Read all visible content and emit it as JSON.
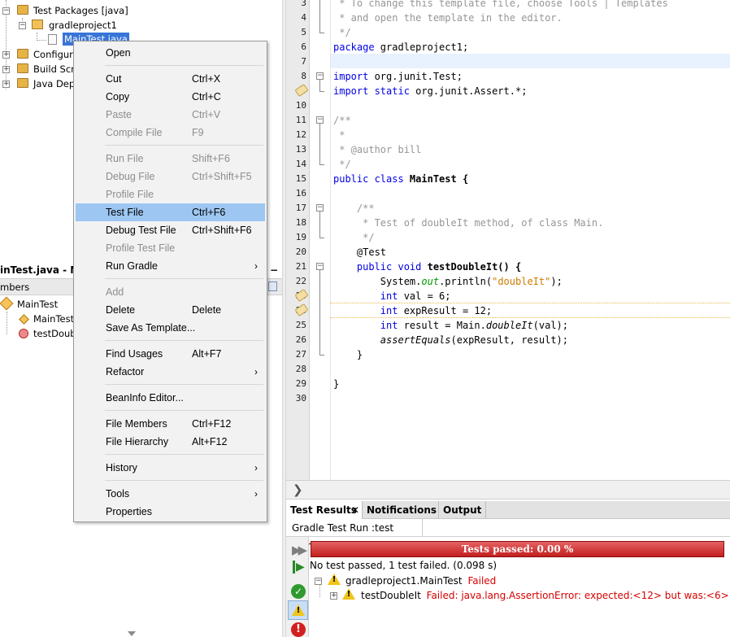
{
  "tree": {
    "test_packages": "Test Packages [java]",
    "package": "gradleproject1",
    "file": "MainTest.java",
    "configuration": "Configura",
    "build_scripts": "Build Scrip",
    "java_dependencies": "Java Depe"
  },
  "navigator": {
    "title": "inTest.java - Navi",
    "members_label": "mbers",
    "class_name": "MainTest",
    "constructor": "MainTest(",
    "method": "testDouble"
  },
  "context_menu": {
    "items": [
      {
        "label": "Open",
        "accel": "",
        "enabled": true
      },
      {
        "label": "Cut",
        "accel": "Ctrl+X",
        "enabled": true
      },
      {
        "label": "Copy",
        "accel": "Ctrl+C",
        "enabled": true
      },
      {
        "label": "Paste",
        "accel": "Ctrl+V",
        "enabled": false
      },
      {
        "label": "Compile File",
        "accel": "F9",
        "enabled": false
      },
      {
        "label": "Run File",
        "accel": "Shift+F6",
        "enabled": false
      },
      {
        "label": "Debug File",
        "accel": "Ctrl+Shift+F5",
        "enabled": false
      },
      {
        "label": "Profile File",
        "accel": "",
        "enabled": false
      },
      {
        "label": "Test File",
        "accel": "Ctrl+F6",
        "enabled": true,
        "highlighted": true
      },
      {
        "label": "Debug Test File",
        "accel": "Ctrl+Shift+F6",
        "enabled": true
      },
      {
        "label": "Profile Test File",
        "accel": "",
        "enabled": false
      },
      {
        "label": "Run Gradle",
        "accel": "",
        "enabled": true,
        "submenu": true
      },
      {
        "label": "Add",
        "accel": "",
        "enabled": false
      },
      {
        "label": "Delete",
        "accel": "Delete",
        "enabled": true
      },
      {
        "label": "Save As Template...",
        "accel": "",
        "enabled": true
      },
      {
        "label": "Find Usages",
        "accel": "Alt+F7",
        "enabled": true
      },
      {
        "label": "Refactor",
        "accel": "",
        "enabled": true,
        "submenu": true
      },
      {
        "label": "BeanInfo Editor...",
        "accel": "",
        "enabled": true
      },
      {
        "label": "File Members",
        "accel": "Ctrl+F12",
        "enabled": true
      },
      {
        "label": "File Hierarchy",
        "accel": "Alt+F12",
        "enabled": true
      },
      {
        "label": "History",
        "accel": "",
        "enabled": true,
        "submenu": true
      },
      {
        "label": "Tools",
        "accel": "",
        "enabled": true,
        "submenu": true
      },
      {
        "label": "Properties",
        "accel": "",
        "enabled": true
      }
    ]
  },
  "editor": {
    "line_numbers": [
      "3",
      "4",
      "5",
      "6",
      "7",
      "8",
      "9",
      "10",
      "11",
      "12",
      "13",
      "14",
      "15",
      "16",
      "17",
      "18",
      "19",
      "20",
      "21",
      "22",
      "23",
      "24",
      "25",
      "26",
      "27",
      "28",
      "29",
      "30"
    ],
    "lines": {
      "l3": " * To change this template file, choose Tools | Templates",
      "l4": " * and open the template in the editor.",
      "l5": " */",
      "l6_kw": "package",
      "l6_rest": " gradleproject1;",
      "l8_kw": "import",
      "l8_rest": " org.junit.Test;",
      "l9_kw": "import static",
      "l9_rest": " org.junit.Assert.*;",
      "l11": "/**",
      "l12": " *",
      "l13": " * @author bill",
      "l14": " */",
      "l15_kw": "public class",
      "l15_rest": " MainTest {",
      "l17": "    /**",
      "l18": "     * Test of doubleIt method, of class Main.",
      "l19": "     */",
      "l20": "    @Test",
      "l21_kw": "    public void",
      "l21_rest": " testDoubleIt() {",
      "l22_a": "        System.",
      "l22_b": "out",
      "l22_c": ".println(",
      "l22_d": "\"doubleIt\"",
      "l22_e": ");",
      "l23_kw": "        int",
      "l23_rest": " val = 6;",
      "l24_kw": "        int",
      "l24_rest": " expResult = 12;",
      "l25_kw": "        int",
      "l25_a": " result = Main.",
      "l25_b": "doubleIt",
      "l25_c": "(val);",
      "l26_a": "        ",
      "l26_b": "assertEquals",
      "l26_c": "(expResult, result);",
      "l27": "    }",
      "l29": "}"
    }
  },
  "bottom": {
    "tabs": [
      "Test Results",
      "Notifications",
      "Output"
    ],
    "subtab": "Gradle Test Run :test started",
    "progress_label": "Tests passed: 0.00 %",
    "progress_fraction": 0.0,
    "summary": "No test passed, 1 test failed. (0.098 s)",
    "suite_name": "gradleproject1.MainTest",
    "suite_status": "Failed",
    "test_name": "testDoubleIt",
    "test_status": "Failed: java.lang.AssertionError: expected:<12> but was:<6>"
  },
  "colors": {
    "selection": "#3875d7",
    "menu_highlight": "#9dc7f2",
    "keyword": "#0000e6",
    "comment": "#969696",
    "failure_red": "#cc0000",
    "progress_red": "#c21f1f"
  }
}
